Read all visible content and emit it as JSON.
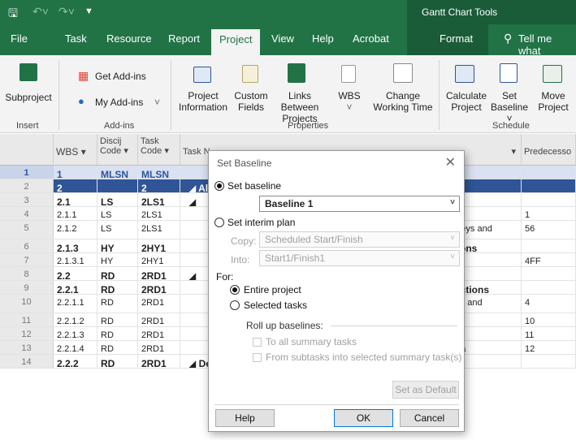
{
  "window": {
    "contextual_title": "Gantt Chart Tools"
  },
  "tabs": [
    "File",
    "Task",
    "Resource",
    "Report",
    "Project",
    "View",
    "Help",
    "Acrobat",
    "Format"
  ],
  "active_tab": "Project",
  "tell_me": "Tell me what",
  "ribbon": {
    "insert_group": {
      "subproject": "Subproject",
      "label": "Insert"
    },
    "addins_group": {
      "get_addins": "Get Add-ins",
      "my_addins": "My Add-ins",
      "label": "Add-ins"
    },
    "properties_group": {
      "project_info_1": "Project",
      "project_info_2": "Information",
      "custom_fields_1": "Custom",
      "custom_fields_2": "Fields",
      "links_1": "Links Between",
      "links_2": "Projects",
      "wbs": "WBS",
      "change_wt_1": "Change",
      "change_wt_2": "Working Time",
      "label": "Properties"
    },
    "schedule_group": {
      "calc_1": "Calculate",
      "calc_2": "Project",
      "setb_1": "Set",
      "setb_2": "Baseline",
      "move_1": "Move",
      "move_2": "Project",
      "label": "Schedule"
    }
  },
  "grid": {
    "headers": {
      "wbs": "WBS",
      "disc_1": "Discij",
      "disc_2": "Code",
      "task_code_1": "Task",
      "task_code_2": "Code",
      "task_name": "Task N",
      "predecessors": "Predecesso"
    },
    "rows": [
      {
        "n": "1",
        "wbs": "1",
        "disc": "MLSN",
        "code": "MLSN",
        "name": "NT",
        "pred": ""
      },
      {
        "n": "2",
        "wbs": "2",
        "disc": "",
        "code": "2",
        "name": "◢ Al",
        "pred": ""
      },
      {
        "n": "3",
        "wbs": "2.1",
        "disc": "LS",
        "code": "2LS1",
        "name": "◢",
        "pred": ""
      },
      {
        "n": "4",
        "wbs": "2.1.1",
        "disc": "LS",
        "code": "2LS1",
        "name": "",
        "pred": "1"
      },
      {
        "n": "5",
        "wbs": "2.1.2",
        "disc": "LS",
        "code": "2LS1",
        "name": "urveys and",
        "pred": "56"
      },
      {
        "n": "6",
        "wbs": "2.1.3",
        "disc": "HY",
        "code": "2HY1",
        "name": "ations",
        "pred": ""
      },
      {
        "n": "7",
        "wbs": "2.1.3.1",
        "disc": "HY",
        "code": "2HY1",
        "name": "",
        "pred": "4FF"
      },
      {
        "n": "8",
        "wbs": "2.2",
        "disc": "RD",
        "code": "2RD1",
        "name": "◢",
        "pred": ""
      },
      {
        "n": "9",
        "wbs": "2.2.1",
        "disc": "RD",
        "code": "2RD1",
        "name": "Sections",
        "pred": ""
      },
      {
        "n": "10",
        "wbs": "2.2.1.1",
        "disc": "RD",
        "code": "2RD1",
        "name": "ions and",
        "pred": "4"
      },
      {
        "n": "11",
        "wbs": "2.2.1.2",
        "disc": "RD",
        "code": "2RD1",
        "name": "",
        "pred": "10"
      },
      {
        "n": "12",
        "wbs": "2.2.1.3",
        "disc": "RD",
        "code": "2RD1",
        "name": "",
        "pred": "11"
      },
      {
        "n": "13",
        "wbs": "2.2.1.4",
        "disc": "RD",
        "code": "2RD1",
        "name": "teria",
        "pred": "12"
      },
      {
        "n": "14",
        "wbs": "2.2.2",
        "disc": "RD",
        "code": "2RD1",
        "name": "◢ Design Recommendation Plan Set",
        "pred": ""
      }
    ]
  },
  "dialog": {
    "title": "Set Baseline",
    "set_baseline": "Set baseline",
    "baseline_value": "Baseline 1",
    "set_interim": "Set interim plan",
    "copy_label": "Copy:",
    "copy_value": "Scheduled Start/Finish",
    "into_label": "Into:",
    "into_value": "Start1/Finish1",
    "for_label": "For:",
    "entire_project": "Entire project",
    "selected_tasks": "Selected tasks",
    "rollup_label": "Roll up baselines:",
    "to_all_summary": "To all summary tasks",
    "from_subtasks": "From subtasks into selected summary task(s)",
    "set_default": "Set as Default",
    "help": "Help",
    "ok": "OK",
    "cancel": "Cancel"
  }
}
